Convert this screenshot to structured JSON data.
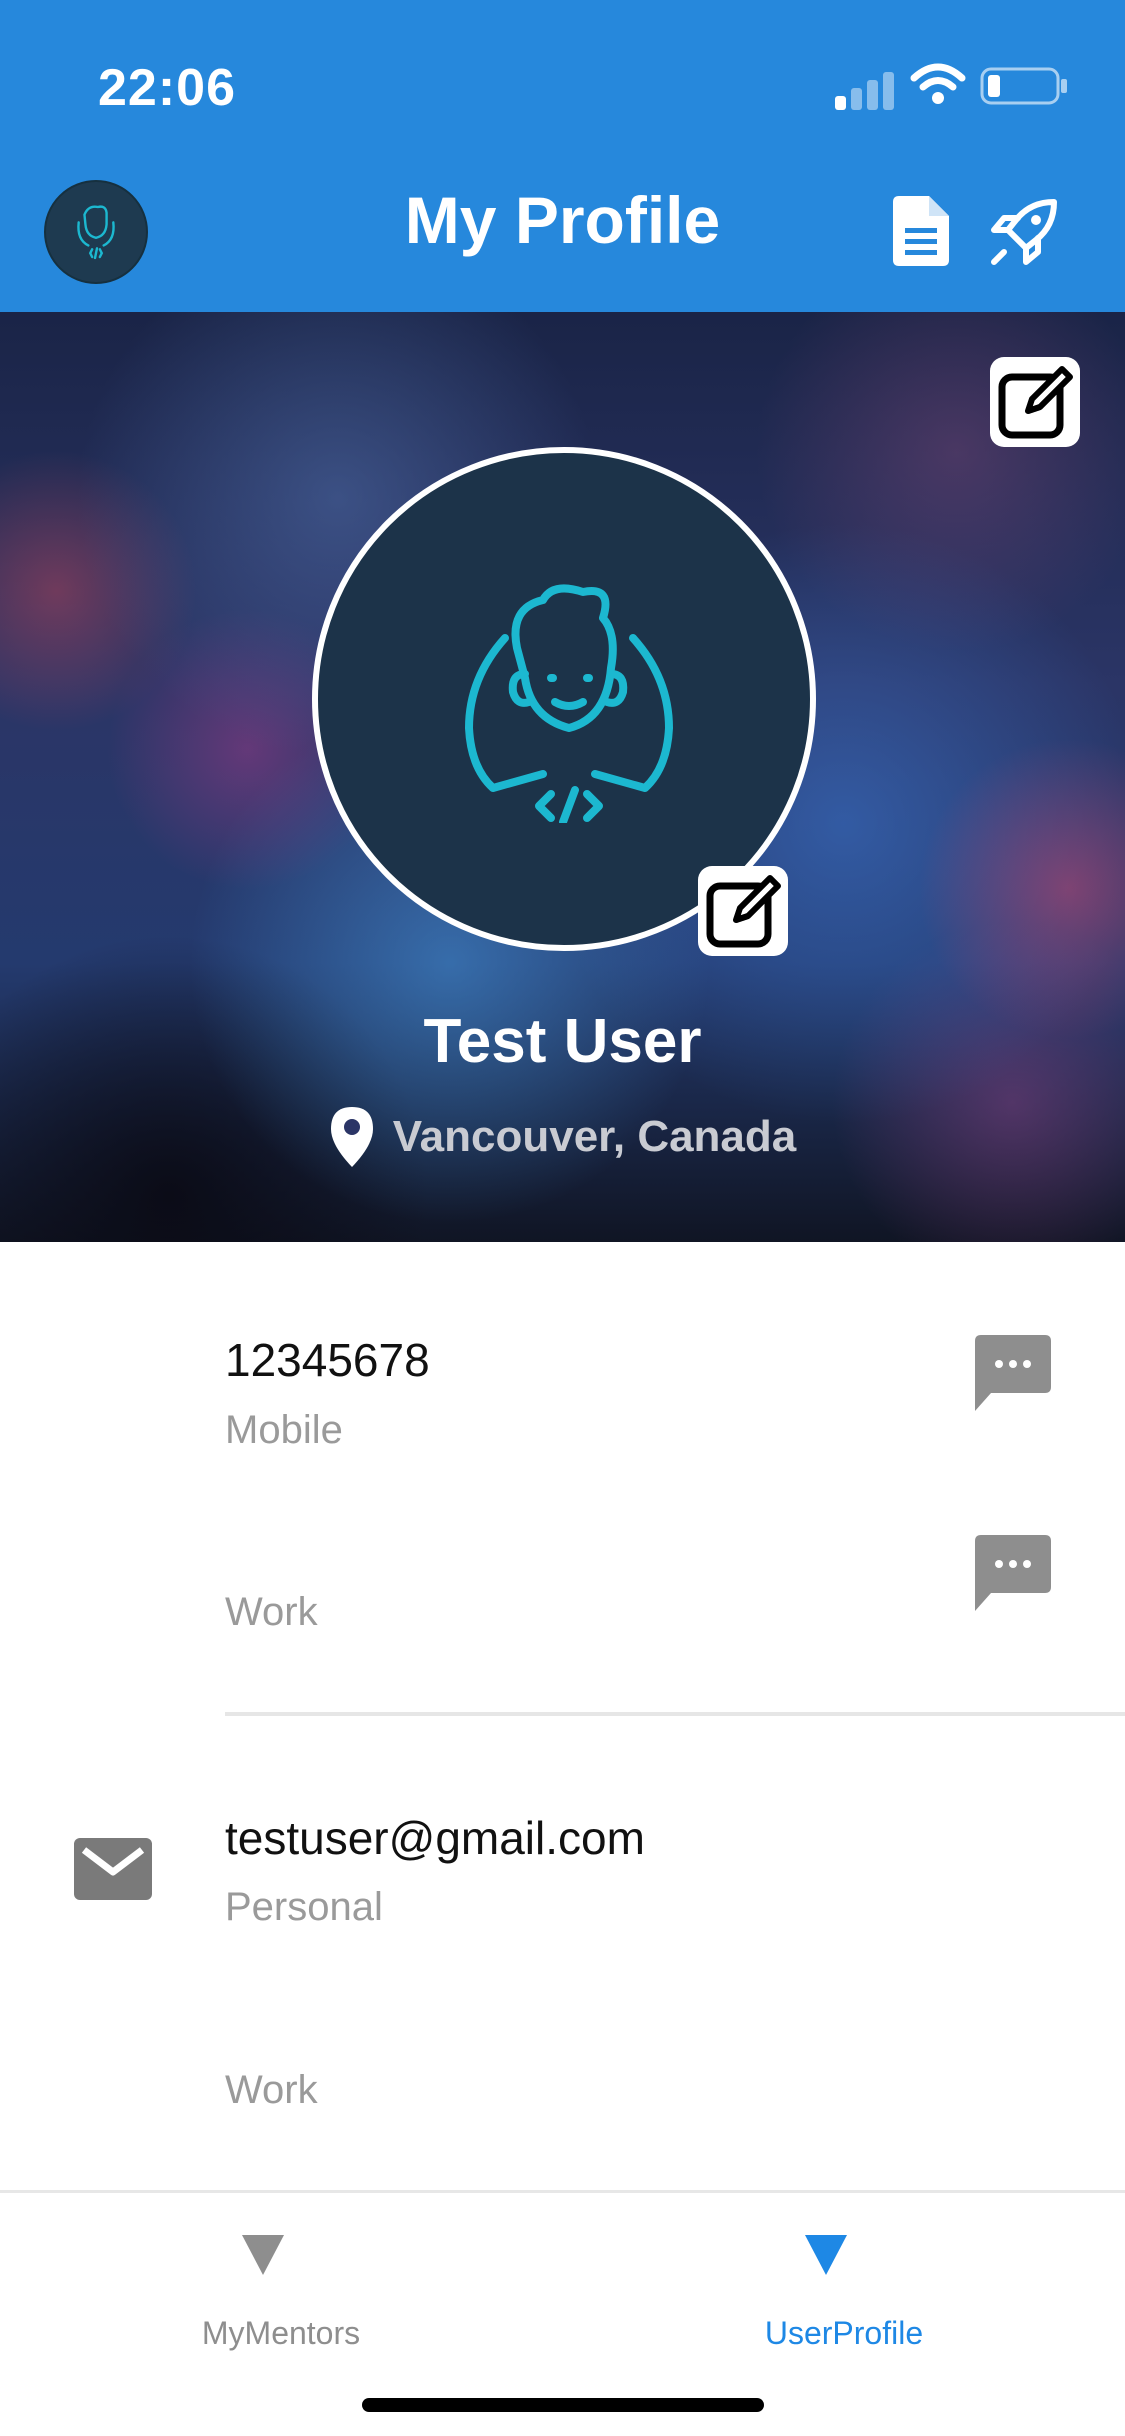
{
  "status_bar": {
    "time": "22:06"
  },
  "nav": {
    "title": "My Profile"
  },
  "profile": {
    "name": "Test User",
    "location": "Vancouver, Canada"
  },
  "phones": [
    {
      "number": "12345678",
      "label": "Mobile"
    },
    {
      "number": "",
      "label": "Work"
    }
  ],
  "emails": [
    {
      "address": "testuser@gmail.com",
      "label": "Personal"
    },
    {
      "address": "",
      "label": "Work"
    }
  ],
  "tabs": [
    {
      "label": "MyMentors",
      "active": false
    },
    {
      "label": "UserProfile",
      "active": true
    }
  ],
  "colors": {
    "header_blue": "#2688DC",
    "active_tab": "#1E88E5",
    "inactive_tab": "#8E8E8E",
    "illustration_cyan": "#1CB8D0",
    "avatar_bg": "#1C3349"
  },
  "icons": [
    "signal-icon",
    "wifi-icon",
    "battery-icon",
    "document-icon",
    "rocket-icon",
    "edit-icon",
    "location-pin-icon",
    "sms-icon",
    "mail-icon"
  ]
}
